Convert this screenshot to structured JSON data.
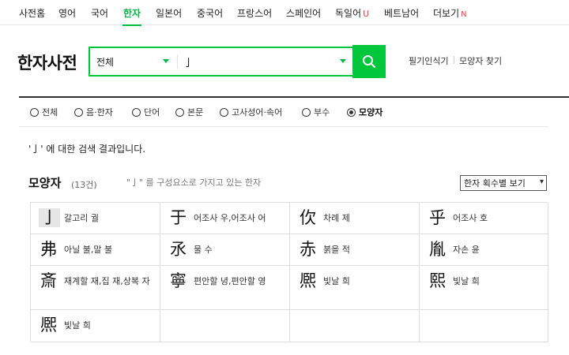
{
  "topnav": {
    "items": [
      {
        "label": "사전홈"
      },
      {
        "label": "영어"
      },
      {
        "label": "국어"
      },
      {
        "label": "한자"
      },
      {
        "label": "일본어"
      },
      {
        "label": "중국어"
      },
      {
        "label": "프랑스어"
      },
      {
        "label": "스페인어"
      },
      {
        "label": "독일어",
        "badge": "U"
      },
      {
        "label": "베트남어"
      },
      {
        "label": "더보기",
        "badge": "N"
      }
    ],
    "active_index": 3
  },
  "header": {
    "logo": "한자사전",
    "search": {
      "scope": "전체",
      "query": "亅"
    },
    "links": [
      "필기인식기",
      "모양자 찾기"
    ]
  },
  "filters": [
    {
      "label": "전체",
      "checked": false
    },
    {
      "label": "음·한자",
      "checked": false
    },
    {
      "label": "단어",
      "checked": false
    },
    {
      "label": "본문",
      "checked": false
    },
    {
      "label": "고사성어·속어",
      "checked": false
    },
    {
      "label": "부수",
      "checked": false
    },
    {
      "label": "모양자",
      "checked": true
    }
  ],
  "result": {
    "text": "'亅' 에 대한 검색 결과입니다."
  },
  "section": {
    "title": "모양자",
    "count": "(13건)",
    "description": "\"亅\" 를 구성요소로 가지고 있는 한자",
    "sort": "한자 획수별 보기"
  },
  "chars": [
    {
      "char": "亅",
      "meaning": "갈고리 궐"
    },
    {
      "char": "于",
      "meaning": "어조사 우,어조사 어"
    },
    {
      "char": "㐸",
      "meaning": "차례 제"
    },
    {
      "char": "乎",
      "meaning": "어조사 호"
    },
    {
      "char": "弗",
      "meaning": "아닐 불,말 불"
    },
    {
      "char": "氶",
      "meaning": "물 수"
    },
    {
      "char": "赤",
      "meaning": "붉을 적"
    },
    {
      "char": "胤",
      "meaning": "자손 윤"
    },
    {
      "char": "斎",
      "meaning": "재계할 재,집 재,상복 자"
    },
    {
      "char": "寧",
      "meaning": "편안할 녕,편안할 영"
    },
    {
      "char": "熈",
      "meaning": "빛날 희"
    },
    {
      "char": "熙",
      "meaning": "빛날 희"
    },
    {
      "char": "熈",
      "meaning": "빛날 희"
    }
  ],
  "colors": {
    "accent": "#00c73c",
    "badge": "#ff3d3d",
    "text": "#222222"
  }
}
